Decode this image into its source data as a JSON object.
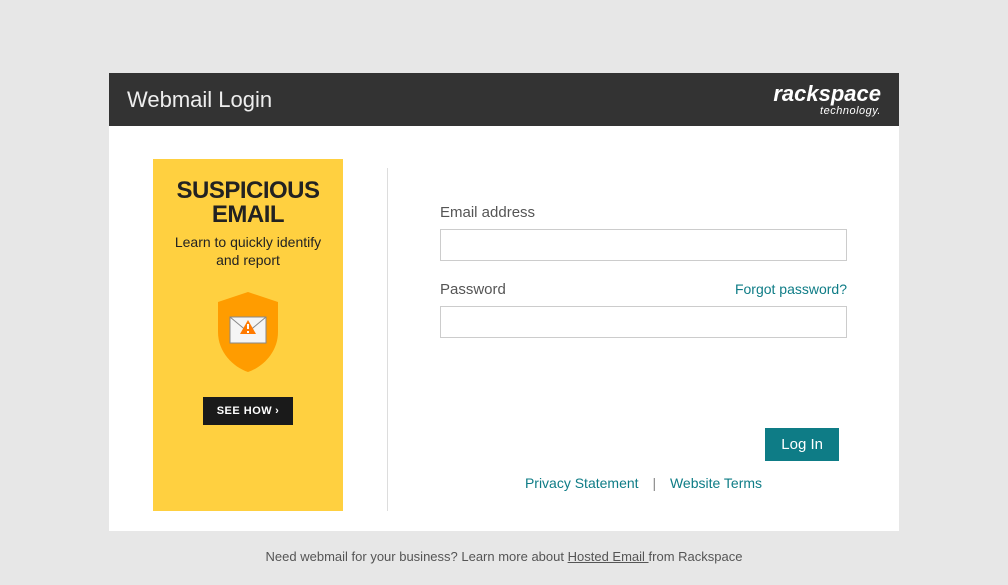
{
  "header": {
    "title": "Webmail Login",
    "logo_main": "rackspace",
    "logo_sub": "technology."
  },
  "promo": {
    "title_line1": "SUSPICIOUS",
    "title_line2": "EMAIL",
    "subtitle": "Learn to quickly identify and report",
    "button_label": "SEE HOW"
  },
  "form": {
    "email_label": "Email address",
    "password_label": "Password",
    "forgot_label": "Forgot password?",
    "login_label": "Log In"
  },
  "footer": {
    "privacy": "Privacy Statement",
    "terms": "Website Terms"
  },
  "bottom": {
    "prefix": "Need webmail for your business? Learn more about ",
    "link": "Hosted Email ",
    "suffix": "from Rackspace"
  }
}
